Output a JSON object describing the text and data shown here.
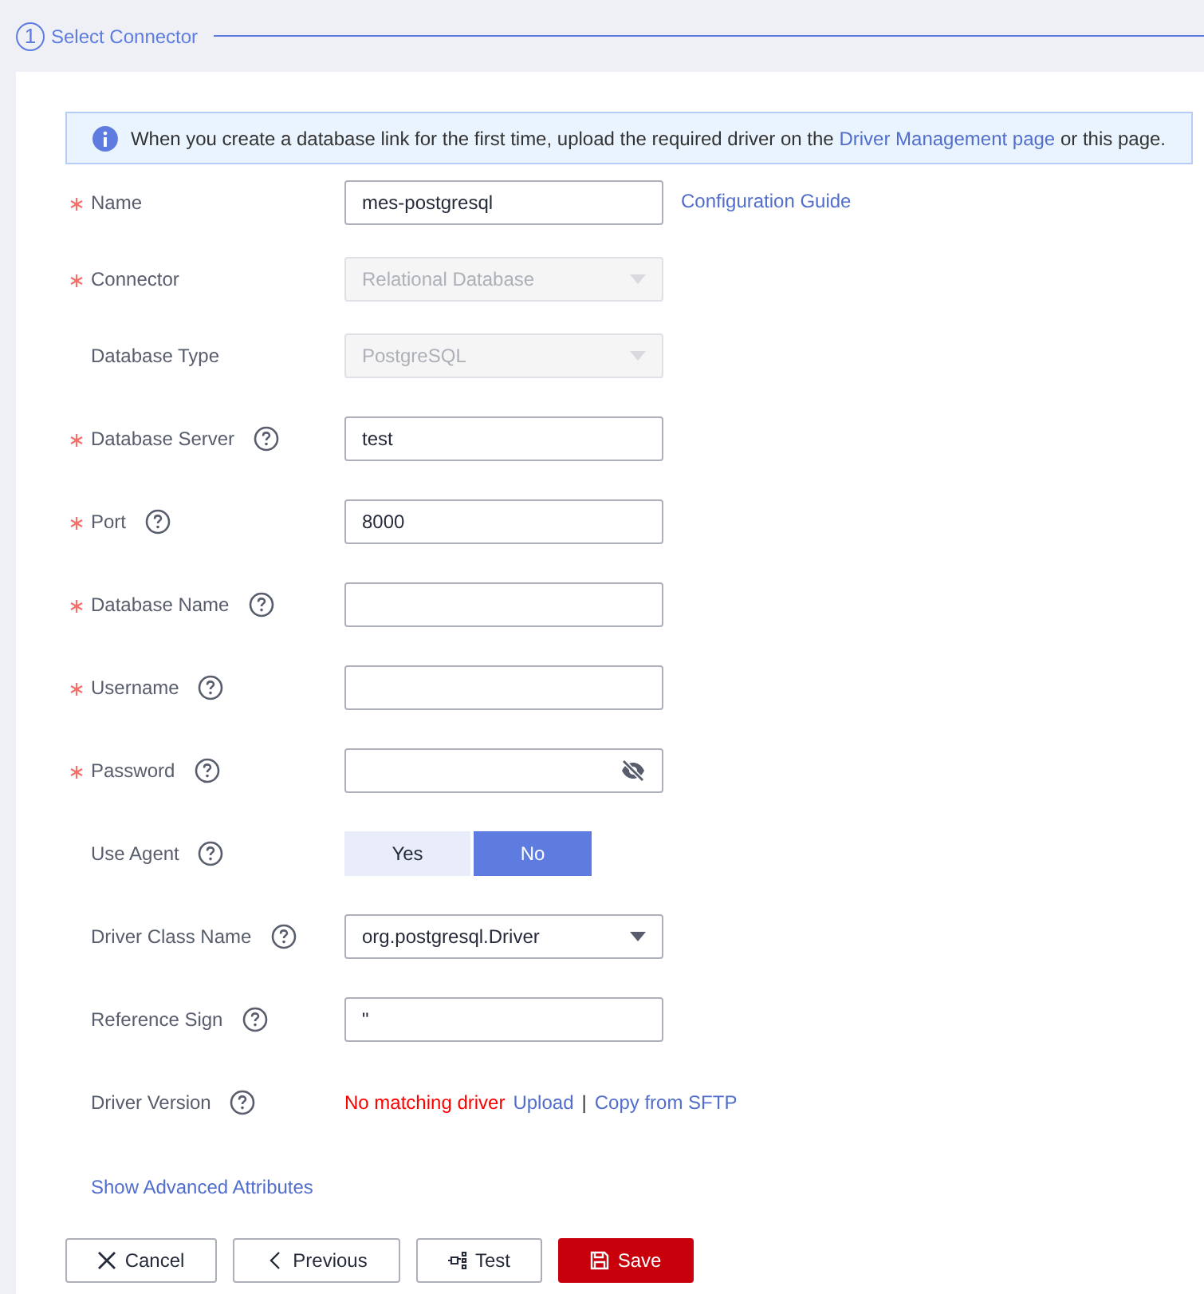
{
  "step": {
    "number": "1",
    "title": "Select Connector"
  },
  "notice": {
    "before": "When you create a database link for the first time, upload the required driver on the",
    "link": "Driver Management page",
    "after": "or this page."
  },
  "fields": [
    {
      "kind": "text",
      "label": "Name",
      "required": true,
      "help": false,
      "value": "mes-postgresql",
      "side_link": "Configuration Guide"
    },
    {
      "kind": "select",
      "label": "Connector",
      "required": true,
      "help": false,
      "value": "Relational Database",
      "disabled": true
    },
    {
      "kind": "select",
      "label": "Database Type",
      "required": false,
      "help": false,
      "value": "PostgreSQL",
      "disabled": true
    },
    {
      "kind": "text",
      "label": "Database Server",
      "required": true,
      "help": true,
      "value": "test"
    },
    {
      "kind": "text",
      "label": "Port",
      "required": true,
      "help": true,
      "value": "8000"
    },
    {
      "kind": "text",
      "label": "Database Name",
      "required": true,
      "help": true
    },
    {
      "kind": "text",
      "label": "Username",
      "required": true,
      "help": true
    },
    {
      "kind": "password",
      "label": "Password",
      "required": true,
      "help": true
    },
    {
      "kind": "toggle",
      "label": "Use Agent",
      "required": false,
      "help": true,
      "options": [
        {
          "label": "Yes",
          "selected": false
        },
        {
          "label": "No",
          "selected": true
        }
      ]
    },
    {
      "kind": "select",
      "label": "Driver Class Name",
      "required": false,
      "help": true,
      "value": "org.postgresql.Driver",
      "disabled": false
    },
    {
      "kind": "text",
      "label": "Reference Sign",
      "required": false,
      "help": true,
      "value": "\""
    },
    {
      "kind": "status",
      "label": "Driver Version",
      "required": false,
      "help": true,
      "status": "No matching driver",
      "links": [
        "Upload",
        "Copy from SFTP"
      ],
      "separator": "|"
    }
  ],
  "advanced_link": "Show Advanced Attributes",
  "buttons": [
    {
      "kind": "cancel",
      "label": "Cancel"
    },
    {
      "kind": "previous",
      "label": "Previous"
    },
    {
      "kind": "test",
      "label": "Test"
    },
    {
      "kind": "save",
      "label": "Save"
    }
  ]
}
